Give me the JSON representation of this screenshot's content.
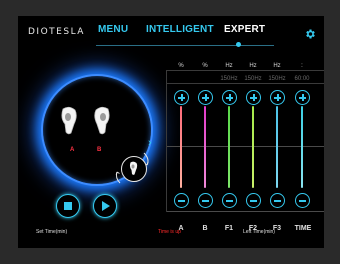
{
  "brand": "DIOTESLA",
  "nav": {
    "menu": "MENU",
    "intelligent": "INTELLIGENT",
    "expert": "EXPERT"
  },
  "channel_labels": {
    "left": "A",
    "right": "B"
  },
  "columns": [
    {
      "label": "A",
      "unit": "%",
      "value": "",
      "color": "#ff6b7a"
    },
    {
      "label": "B",
      "unit": "%",
      "value": "",
      "color": "#e23ac9"
    },
    {
      "label": "F1",
      "unit": "Hz",
      "value": "150Hz",
      "color": "#59d94a"
    },
    {
      "label": "F2",
      "unit": "Hz",
      "value": "150Hz",
      "color": "#a4ea4a"
    },
    {
      "label": "F3",
      "unit": "Hz",
      "value": "150Hz",
      "color": "#4bc3e8"
    },
    {
      "label": "TIME",
      "unit": ":",
      "value": "60:00",
      "color": "#3bd0e4"
    }
  ],
  "footer": {
    "set_time": "Set Time(min)",
    "time_is_up": "Time is up",
    "left_time": "Left Time(min)"
  },
  "icons": {
    "settings": "gear-icon",
    "stop": "stop-icon",
    "play": "play-icon",
    "expand": "chevron-right-icon"
  }
}
